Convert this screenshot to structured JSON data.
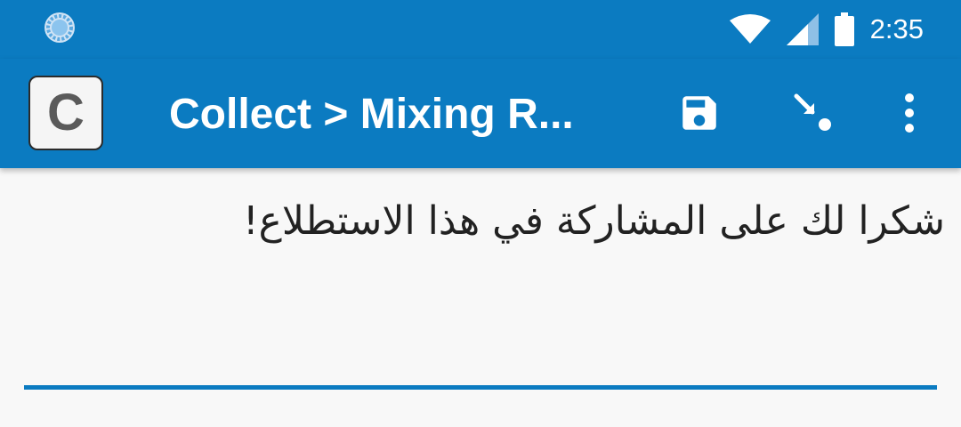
{
  "status_bar": {
    "time": "2:35",
    "left_icon": "sync-spinner-icon",
    "icons": [
      "wifi-icon",
      "cellular-signal-icon",
      "battery-icon"
    ]
  },
  "app_bar": {
    "icon_letter": "C",
    "title": "Collect > Mixing R...",
    "actions": [
      "save-icon",
      "jump-icon",
      "more-vert-icon"
    ]
  },
  "content": {
    "question_text": "شكرا لك على المشاركة في هذا الاستطلاع!"
  },
  "colors": {
    "primary": "#0b7bc1",
    "background": "#f8f8f8",
    "text": "#222222"
  }
}
